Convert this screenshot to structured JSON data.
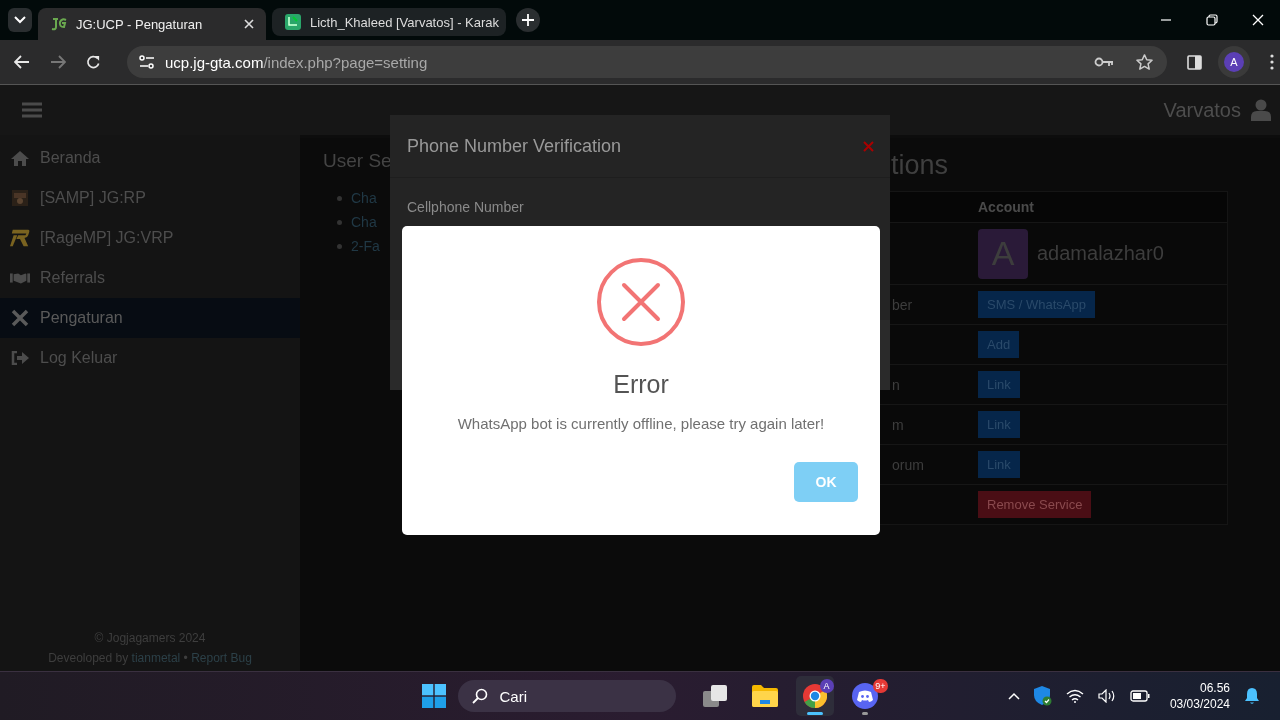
{
  "browser": {
    "tabs": [
      {
        "title": "JG:UCP - Pengaturan",
        "selected": true,
        "kind": "jg"
      },
      {
        "title": "Licth_Khaleed [Varvatos] - Karak",
        "selected": false,
        "kind": "forum"
      }
    ],
    "url": {
      "host": "ucp.jg-gta.com",
      "path": "/index.php?page=setting"
    },
    "profile_initial": "A"
  },
  "navbar": {
    "username": "Varvatos"
  },
  "sidebar": {
    "items": [
      {
        "label": "Beranda",
        "kind": "home",
        "selected": false
      },
      {
        "label": "[SAMP] JG:RP",
        "kind": "samp",
        "selected": false
      },
      {
        "label": "[RageMP] JG:VRP",
        "kind": "ragemp",
        "selected": false
      },
      {
        "label": "Referrals",
        "kind": "handshake",
        "selected": false
      },
      {
        "label": "Pengaturan",
        "kind": "tools",
        "selected": true
      },
      {
        "label": "Log Keluar",
        "kind": "logout",
        "selected": false
      }
    ],
    "footer": {
      "copyright": "© Jogjagamers 2024",
      "developed_prefix": "Deveoloped by",
      "author": "tianmetal",
      "separator": "•",
      "report": "Report Bug"
    }
  },
  "user_settings": {
    "title": "User Se",
    "items": [
      "Cha",
      "Cha",
      "2-Fa"
    ]
  },
  "associations": {
    "title": "tions",
    "account_header": "Account",
    "rows": [
      {
        "kind": "account",
        "avatar_letter": "A",
        "account": "adamalazhar0"
      },
      {
        "kind": "primary_button",
        "label": "ber",
        "button": "SMS / WhatsApp"
      },
      {
        "kind": "primary_button",
        "button": "Add"
      },
      {
        "kind": "primary_button",
        "label": "n",
        "button": "Link"
      },
      {
        "kind": "primary_button",
        "label": "m",
        "button": "Link"
      },
      {
        "kind": "primary_button",
        "label": "orum",
        "button": "Link"
      },
      {
        "kind": "danger_button",
        "button": "Remove Service"
      }
    ]
  },
  "phone_modal": {
    "title": "Phone Number Verification",
    "field_label": "Cellphone Number"
  },
  "error_dialog": {
    "title": "Error",
    "message": "WhatsApp bot is currently offline, please try again later!",
    "button": "OK"
  },
  "taskbar": {
    "search_placeholder": "Cari",
    "apps": [
      {
        "kind": "taskview",
        "selected": false,
        "running": false
      },
      {
        "kind": "explorer",
        "selected": false,
        "running": false
      },
      {
        "kind": "chrome",
        "selected": true,
        "running": true,
        "badge": "A"
      },
      {
        "kind": "discord",
        "selected": false,
        "running": true,
        "badge": "9+"
      }
    ],
    "time": "06.56",
    "date": "03/03/2024"
  }
}
